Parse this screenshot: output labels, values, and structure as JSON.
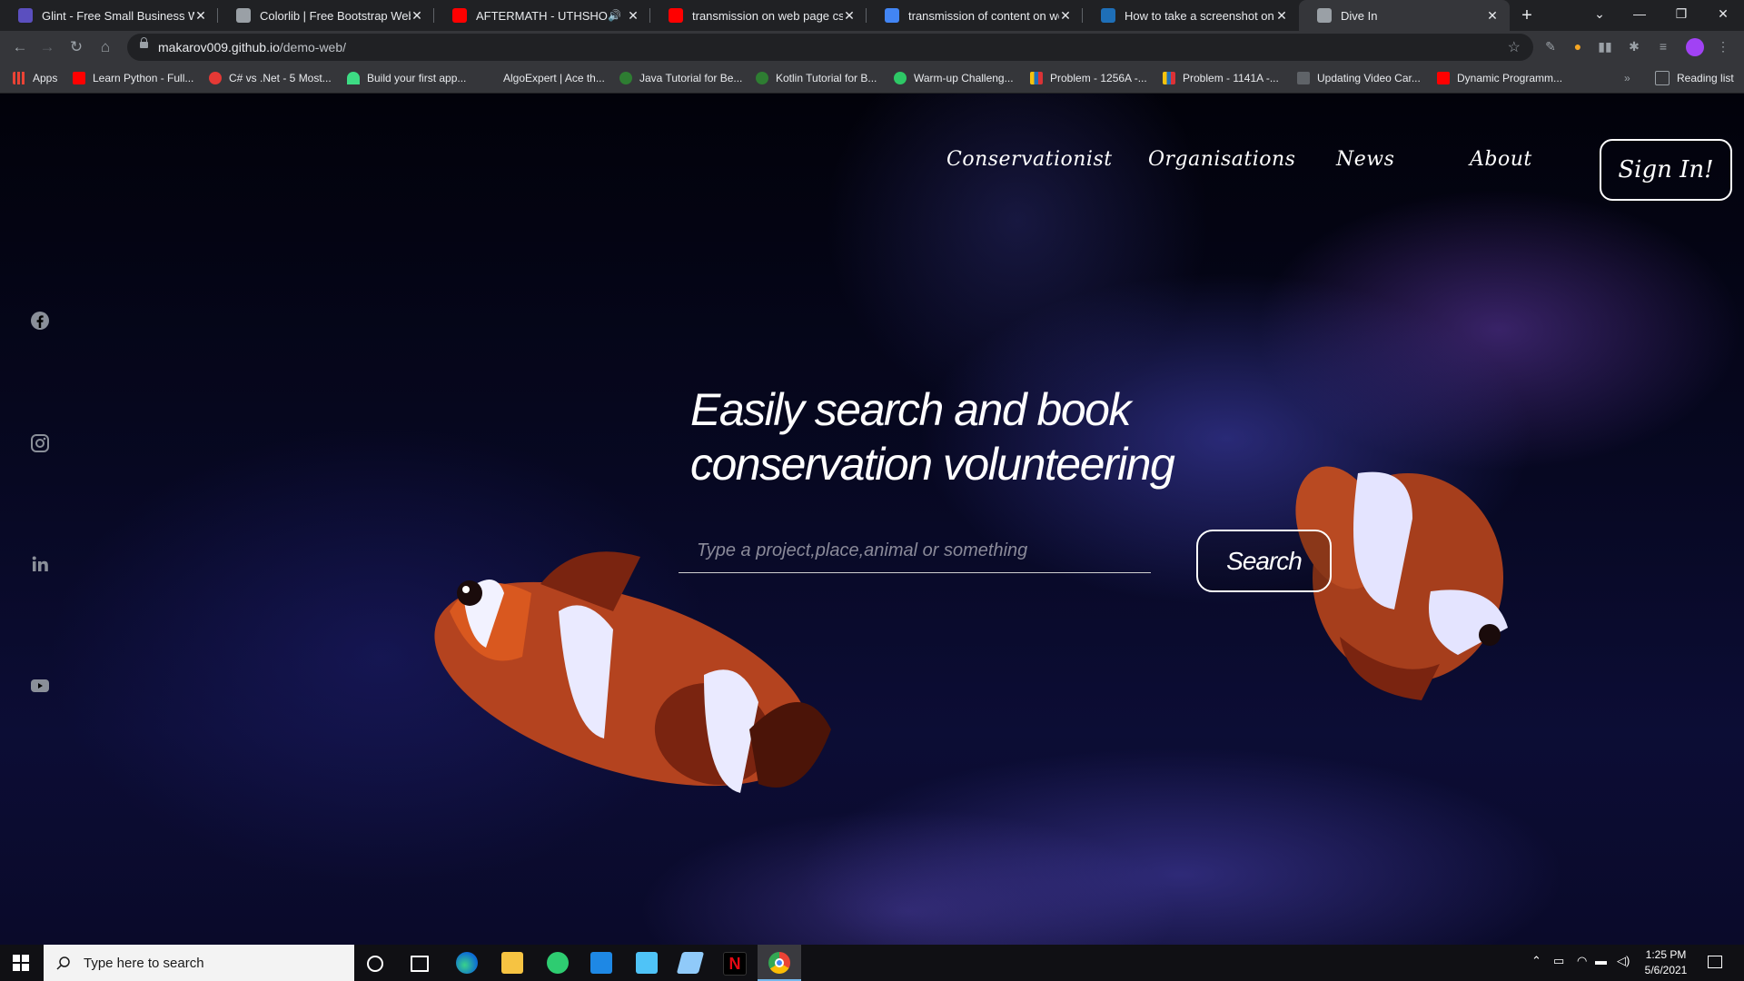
{
  "browser": {
    "tabs": [
      {
        "title": "Glint - Free Small Business Website",
        "favicon_color": "#5b4fbf",
        "active": false
      },
      {
        "title": "Colorlib | Free Bootstrap Website",
        "favicon_color": "#9aa0a6",
        "active": false
      },
      {
        "title": "AFTERMATH - UTHSHORGO",
        "favicon_color": "#ff0000",
        "active": false
      },
      {
        "title": "transmission on web page css - YouTube",
        "favicon_color": "#ff0000",
        "active": false
      },
      {
        "title": "transmission of content on webpage",
        "favicon_color": "#4285f4",
        "active": false
      },
      {
        "title": "How to take a screenshot on any",
        "favicon_color": "#1e6fb8",
        "active": false
      },
      {
        "title": "Dive In",
        "favicon_color": "#9aa0a6",
        "active": true
      }
    ],
    "new_tab_icon": "plus-icon",
    "url_host": "makarov009.github.io",
    "url_path": "/demo-web/",
    "bookmarks": [
      {
        "label": "Apps",
        "favicon_color": "#4285f4"
      },
      {
        "label": "Learn Python - Full...",
        "favicon_color": "#ff0000"
      },
      {
        "label": "C# vs .Net - 5 Most...",
        "favicon_color": "#e53935"
      },
      {
        "label": "Build your first app...",
        "favicon_color": "#3ddc84"
      },
      {
        "label": "AlgoExpert | Ace th...",
        "favicon_color": "#1a73e8"
      },
      {
        "label": "Java Tutorial for Be...",
        "favicon_color": "#2e7d32"
      },
      {
        "label": "Kotlin Tutorial for B...",
        "favicon_color": "#2e7d32"
      },
      {
        "label": "Warm-up Challeng...",
        "favicon_color": "#2ec866"
      },
      {
        "label": "Problem - 1256A -...",
        "favicon_color": "#1e6fb8"
      },
      {
        "label": "Problem - 1141A -...",
        "favicon_color": "#1e6fb8"
      },
      {
        "label": "Updating Video Car...",
        "favicon_color": "#9aa0a6"
      },
      {
        "label": "Dynamic Programm...",
        "favicon_color": "#ff0000"
      }
    ],
    "reading_list": "Reading list"
  },
  "site": {
    "nav": [
      "Conservationist",
      "Organisations",
      "News",
      "About"
    ],
    "sign_in": "Sign In!",
    "social_icons": [
      "facebook-icon",
      "instagram-icon",
      "linkedin-icon",
      "youtube-icon"
    ],
    "headline_line1": "Easily search and book",
    "headline_line2": "conservation volunteering",
    "search_placeholder": "Type a project,place,animal or something",
    "search_button": "Search"
  },
  "taskbar": {
    "search_placeholder": "Type here to search",
    "time": "1:25 PM",
    "date": "5/6/2021"
  }
}
